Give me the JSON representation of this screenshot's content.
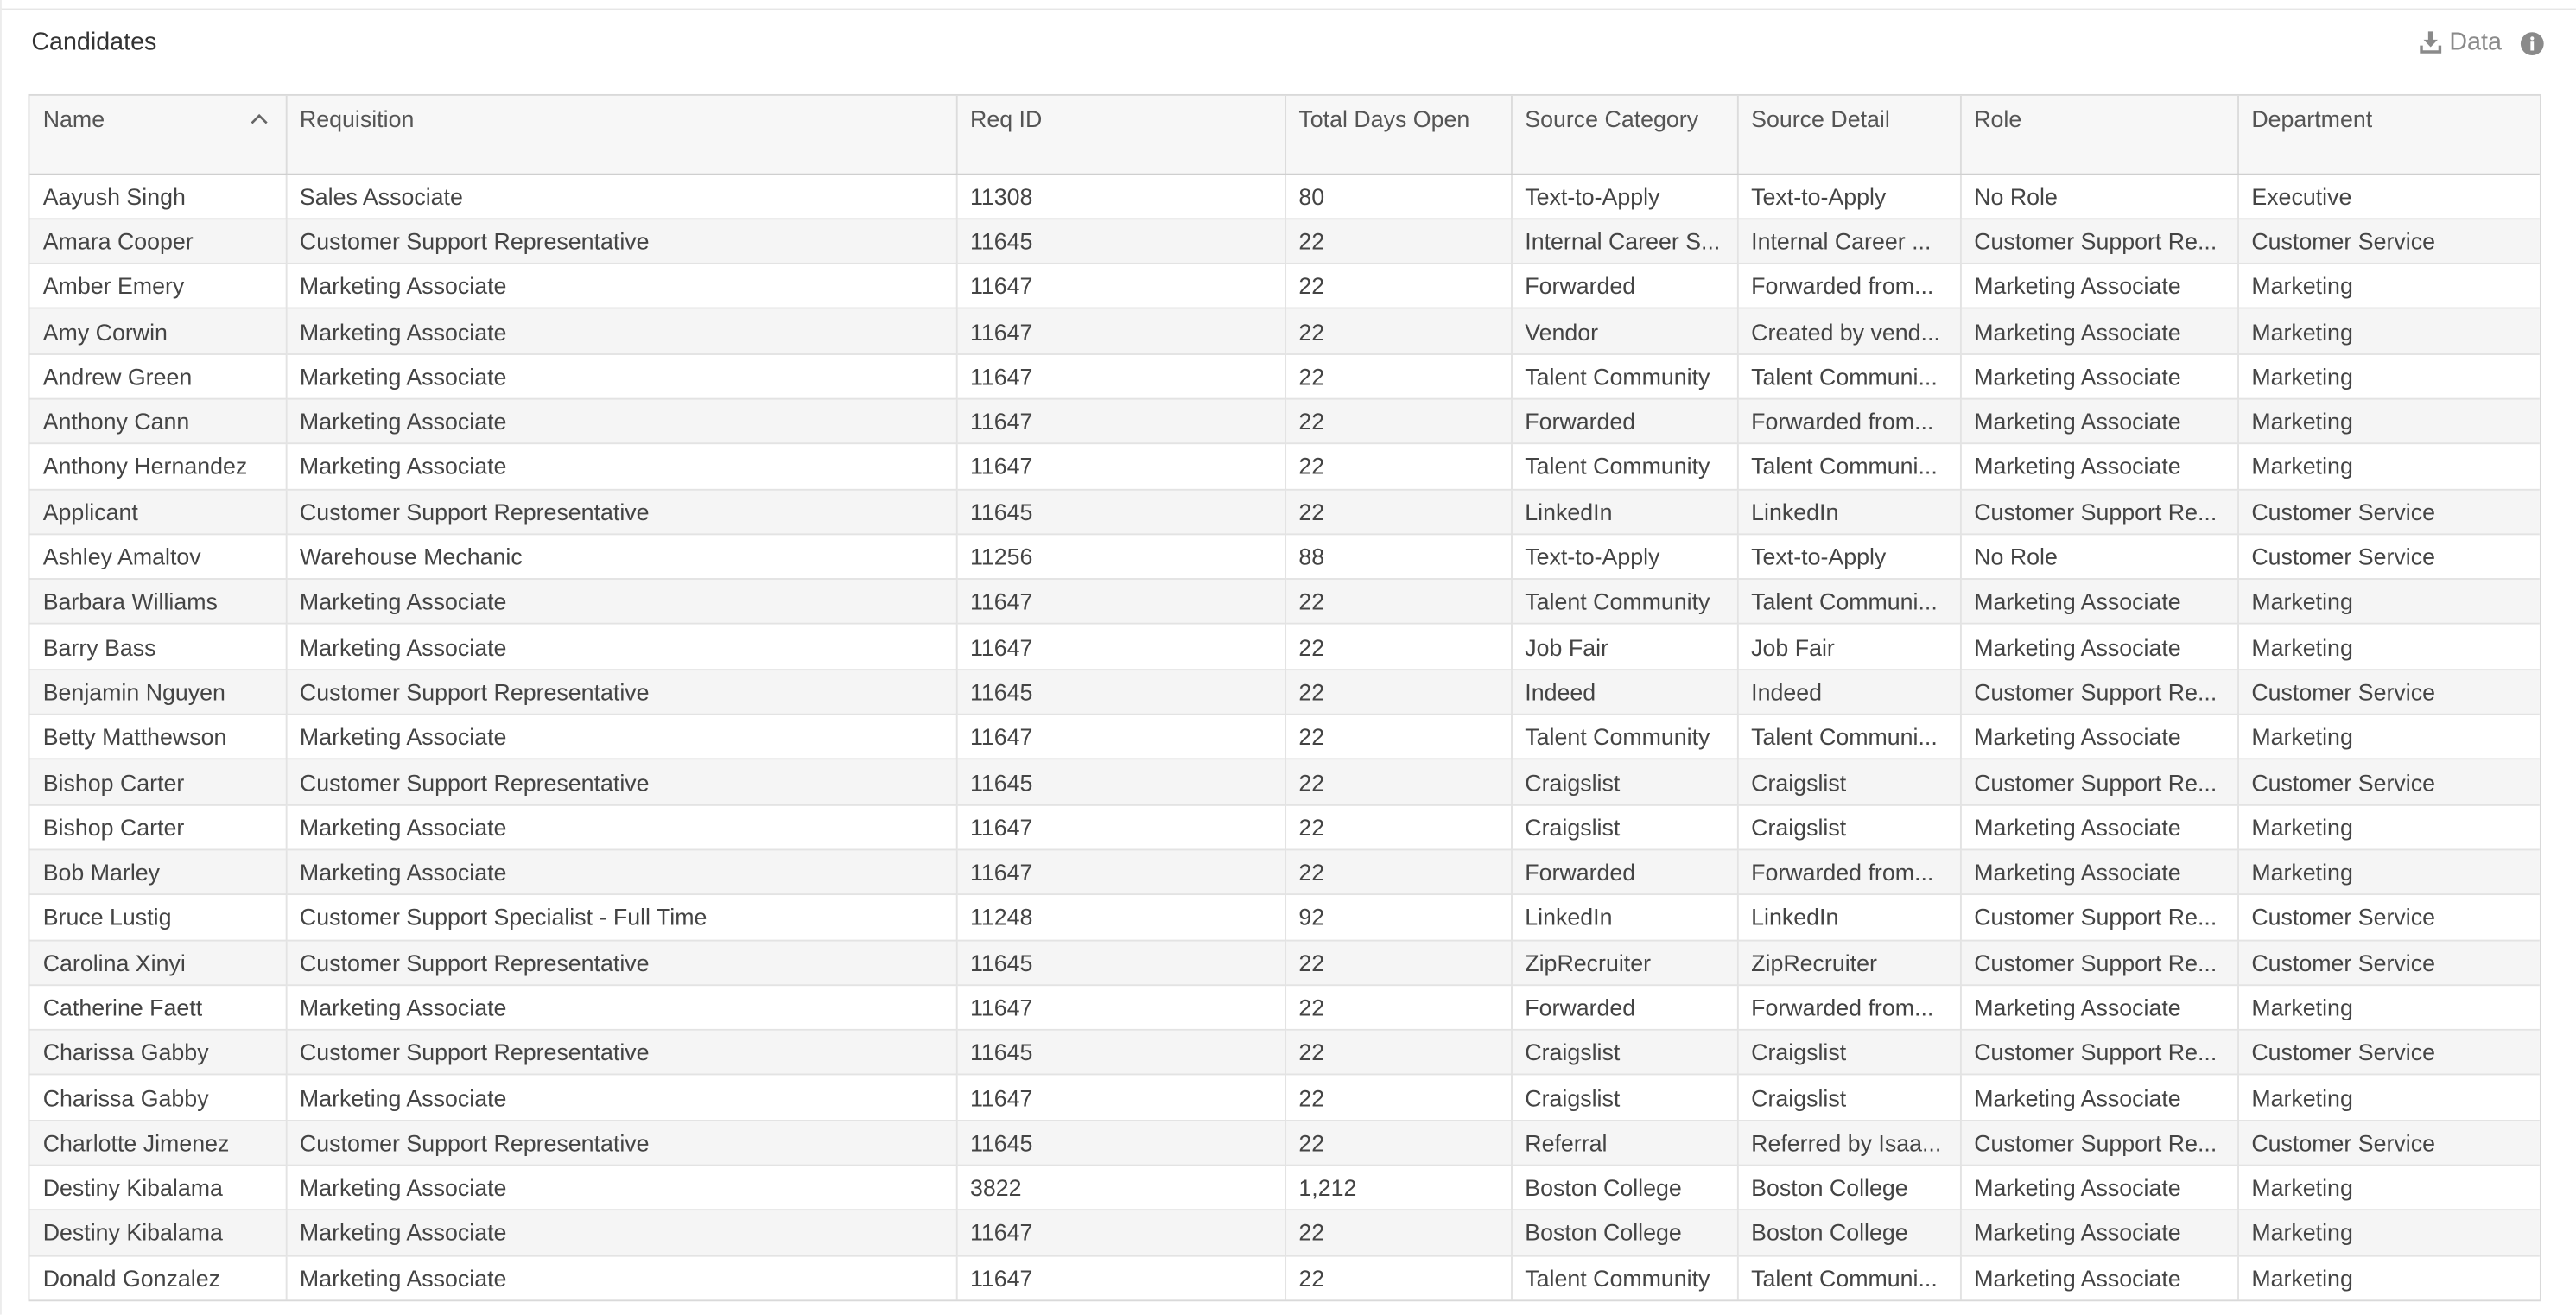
{
  "panel": {
    "title": "Candidates",
    "download_label": "Data",
    "download_icon": "download-icon",
    "info_icon": "info-icon"
  },
  "columns": [
    {
      "key": "name",
      "label": "Name",
      "sorted": "ascending"
    },
    {
      "key": "requisition",
      "label": "Requisition"
    },
    {
      "key": "req_id",
      "label": "Req ID"
    },
    {
      "key": "total_days_open",
      "label": "Total Days Open"
    },
    {
      "key": "source_category",
      "label": "Source Category"
    },
    {
      "key": "source_detail",
      "label": "Source Detail"
    },
    {
      "key": "role",
      "label": "Role"
    },
    {
      "key": "department",
      "label": "Department"
    }
  ],
  "rows": [
    [
      "Aayush Singh",
      "Sales Associate",
      "11308",
      "80",
      "Text-to-Apply",
      "Text-to-Apply",
      "No Role",
      "Executive"
    ],
    [
      "Amara Cooper",
      "Customer Support Representative",
      "11645",
      "22",
      "Internal Career S...",
      "Internal Career ...",
      "Customer Support Re...",
      "Customer Service"
    ],
    [
      "Amber Emery",
      "Marketing Associate",
      "11647",
      "22",
      "Forwarded",
      "Forwarded from...",
      "Marketing Associate",
      "Marketing"
    ],
    [
      "Amy Corwin",
      "Marketing Associate",
      "11647",
      "22",
      "Vendor",
      "Created by vend...",
      "Marketing Associate",
      "Marketing"
    ],
    [
      "Andrew Green",
      "Marketing Associate",
      "11647",
      "22",
      "Talent Community",
      "Talent Communi...",
      "Marketing Associate",
      "Marketing"
    ],
    [
      "Anthony Cann",
      "Marketing Associate",
      "11647",
      "22",
      "Forwarded",
      "Forwarded from...",
      "Marketing Associate",
      "Marketing"
    ],
    [
      "Anthony Hernandez",
      "Marketing Associate",
      "11647",
      "22",
      "Talent Community",
      "Talent Communi...",
      "Marketing Associate",
      "Marketing"
    ],
    [
      "Applicant",
      "Customer Support Representative",
      "11645",
      "22",
      "LinkedIn",
      "LinkedIn",
      "Customer Support Re...",
      "Customer Service"
    ],
    [
      "Ashley Amaltov",
      "Warehouse Mechanic",
      "11256",
      "88",
      "Text-to-Apply",
      "Text-to-Apply",
      "No Role",
      "Customer Service"
    ],
    [
      "Barbara Williams",
      "Marketing Associate",
      "11647",
      "22",
      "Talent Community",
      "Talent Communi...",
      "Marketing Associate",
      "Marketing"
    ],
    [
      "Barry Bass",
      "Marketing Associate",
      "11647",
      "22",
      "Job Fair",
      "Job Fair",
      "Marketing Associate",
      "Marketing"
    ],
    [
      "Benjamin Nguyen",
      "Customer Support Representative",
      "11645",
      "22",
      "Indeed",
      "Indeed",
      "Customer Support Re...",
      "Customer Service"
    ],
    [
      "Betty Matthewson",
      "Marketing Associate",
      "11647",
      "22",
      "Talent Community",
      "Talent Communi...",
      "Marketing Associate",
      "Marketing"
    ],
    [
      "Bishop Carter",
      "Customer Support Representative",
      "11645",
      "22",
      "Craigslist",
      "Craigslist",
      "Customer Support Re...",
      "Customer Service"
    ],
    [
      "Bishop Carter",
      "Marketing Associate",
      "11647",
      "22",
      "Craigslist",
      "Craigslist",
      "Marketing Associate",
      "Marketing"
    ],
    [
      "Bob Marley",
      "Marketing Associate",
      "11647",
      "22",
      "Forwarded",
      "Forwarded from...",
      "Marketing Associate",
      "Marketing"
    ],
    [
      "Bruce Lustig",
      "Customer Support Specialist - Full Time",
      "11248",
      "92",
      "LinkedIn",
      "LinkedIn",
      "Customer Support Re...",
      "Customer Service"
    ],
    [
      "Carolina Xinyi",
      "Customer Support Representative",
      "11645",
      "22",
      "ZipRecruiter",
      "ZipRecruiter",
      "Customer Support Re...",
      "Customer Service"
    ],
    [
      "Catherine Faett",
      "Marketing Associate",
      "11647",
      "22",
      "Forwarded",
      "Forwarded from...",
      "Marketing Associate",
      "Marketing"
    ],
    [
      "Charissa Gabby",
      "Customer Support Representative",
      "11645",
      "22",
      "Craigslist",
      "Craigslist",
      "Customer Support Re...",
      "Customer Service"
    ],
    [
      "Charissa Gabby",
      "Marketing Associate",
      "11647",
      "22",
      "Craigslist",
      "Craigslist",
      "Marketing Associate",
      "Marketing"
    ],
    [
      "Charlotte Jimenez",
      "Customer Support Representative",
      "11645",
      "22",
      "Referral",
      "Referred by Isaa...",
      "Customer Support Re...",
      "Customer Service"
    ],
    [
      "Destiny Kibalama",
      "Marketing Associate",
      "3822",
      "1,212",
      "Boston College",
      "Boston College",
      "Marketing Associate",
      "Marketing"
    ],
    [
      "Destiny Kibalama",
      "Marketing Associate",
      "11647",
      "22",
      "Boston College",
      "Boston College",
      "Marketing Associate",
      "Marketing"
    ],
    [
      "Donald Gonzalez",
      "Marketing Associate",
      "11647",
      "22",
      "Talent Community",
      "Talent Communi...",
      "Marketing Associate",
      "Marketing"
    ]
  ]
}
